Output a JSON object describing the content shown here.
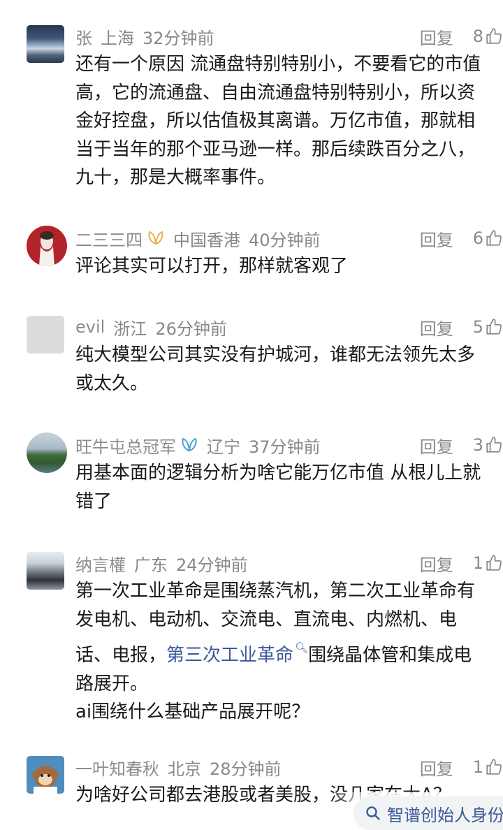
{
  "comments": [
    {
      "user": "张",
      "location": "上海",
      "time": "32分钟前",
      "reply_label": "回复",
      "likes": "8",
      "lines": [
        "还有一个原因 流通盘特别特别小，不要看它的市值",
        "高，它的流通盘、自由流通盘特别特别小，所以资",
        "金好控盘，所以估值极其离谱。万亿市值，那就相",
        "当于当年的那个亚马逊一样。那后续跌百分之八，",
        "九十，那是大概率事件。"
      ]
    },
    {
      "user": "二三三四",
      "location": "中国香港",
      "time": "40分钟前",
      "reply_label": "回复",
      "likes": "6",
      "lines": [
        "评论其实可以打开，那样就客观了"
      ]
    },
    {
      "user": "evil",
      "location": "浙江",
      "time": "26分钟前",
      "reply_label": "回复",
      "likes": "5",
      "lines": [
        "纯大模型公司其实没有护城河，谁都无法领先太多",
        "或太久。"
      ]
    },
    {
      "user": "旺牛屯总冠军",
      "location": "辽宁",
      "time": "37分钟前",
      "reply_label": "回复",
      "likes": "3",
      "lines": [
        "用基本面的逻辑分析为啥它能万亿市值 从根儿上就",
        "错了"
      ]
    },
    {
      "user": "纳言權",
      "location": "广东",
      "time": "24分钟前",
      "reply_label": "回复",
      "likes": "1",
      "lines": [
        "第一次工业革命是围绕蒸汽机，第二次工业革命有",
        "发电机、电动机、交流电、直流电、内燃机、电"
      ],
      "line3_pre": "话、电报，",
      "line3_link": "第三次工业革命",
      "line3_post": "围绕晶体管和集成电",
      "line4": "路展开。",
      "line5": "ai围绕什么基础产品展开呢？"
    },
    {
      "user": "一叶知春秋",
      "location": "北京",
      "time": "28分钟前",
      "reply_label": "回复",
      "likes": "1",
      "lines": [
        "为啥好公司都去港股或者美股，没几家在大A？"
      ]
    }
  ],
  "search_suggestion": "智谱创始人身份",
  "colors": {
    "link": "#3b5b9a",
    "meta": "#888888",
    "text": "#191919"
  }
}
